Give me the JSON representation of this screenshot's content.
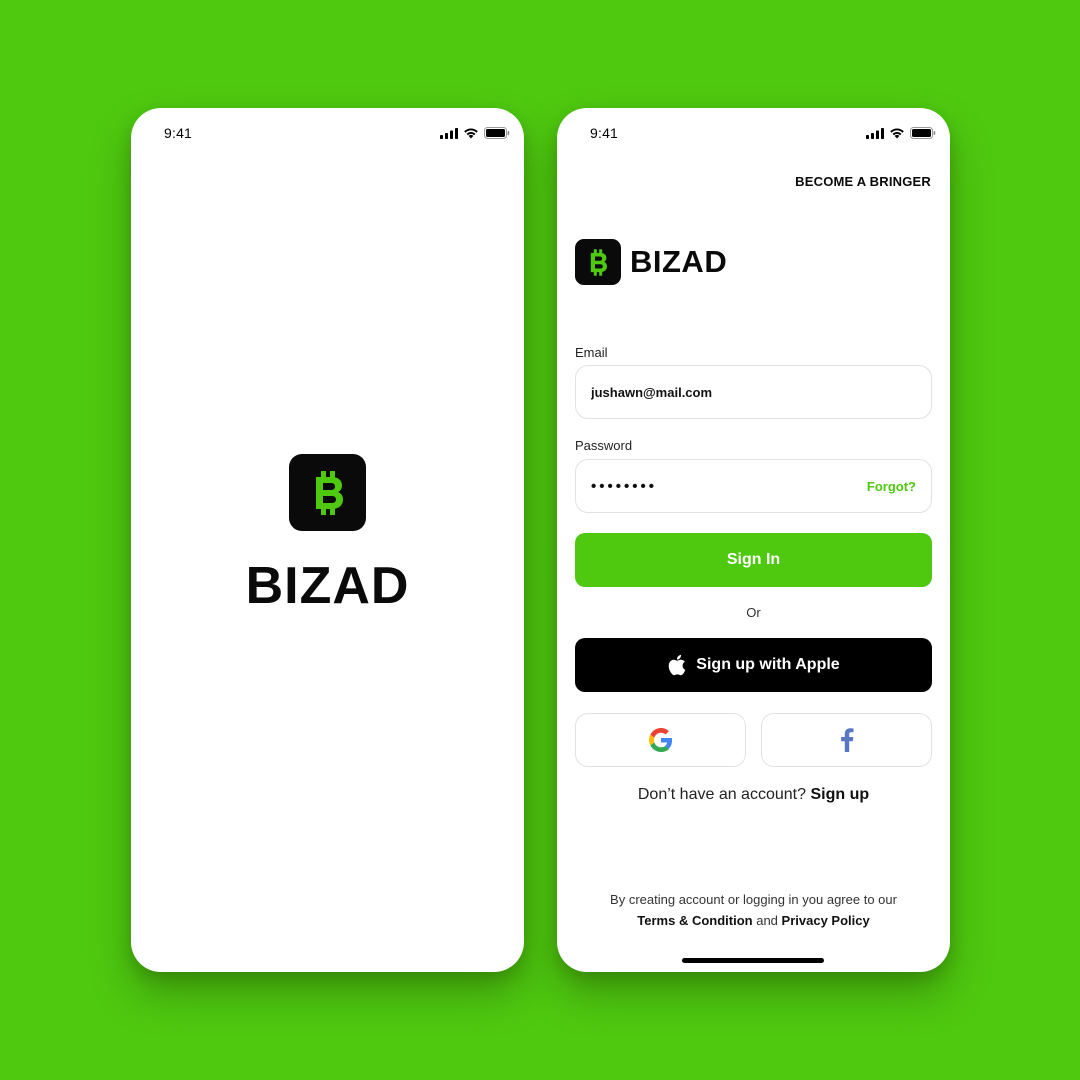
{
  "colors": {
    "background": "#4fc910",
    "accent": "#4fc910",
    "dark": "#0a0a0a"
  },
  "splash_screen": {
    "status_bar": {
      "time": "9:41",
      "icons": [
        "signal-icon",
        "wifi-icon",
        "battery-icon"
      ]
    },
    "logo_icon": "bitcoin-b-icon",
    "brand_name": "BIZAD"
  },
  "login_screen": {
    "status_bar": {
      "time": "9:41",
      "icons": [
        "signal-icon",
        "wifi-icon",
        "battery-icon"
      ]
    },
    "become_bringer_link": "BECOME A BRINGER",
    "brand_name": "BIZAD",
    "email": {
      "label": "Email",
      "value": "jushawn@mail.com"
    },
    "password": {
      "label": "Password",
      "masked_value": "••••••••",
      "forgot_label": "Forgot?"
    },
    "sign_in_button": "Sign In",
    "divider_text": "Or",
    "apple_button": "Sign up with Apple",
    "social_buttons": [
      "google-icon",
      "facebook-icon"
    ],
    "signup_prompt": {
      "text": "Don’t have an account?",
      "link": "Sign up"
    },
    "terms": {
      "line1": "By creating account or logging in you agree to our",
      "terms_link": "Terms & Condition",
      "connector": "and",
      "privacy_link": "Privacy Policy"
    }
  }
}
